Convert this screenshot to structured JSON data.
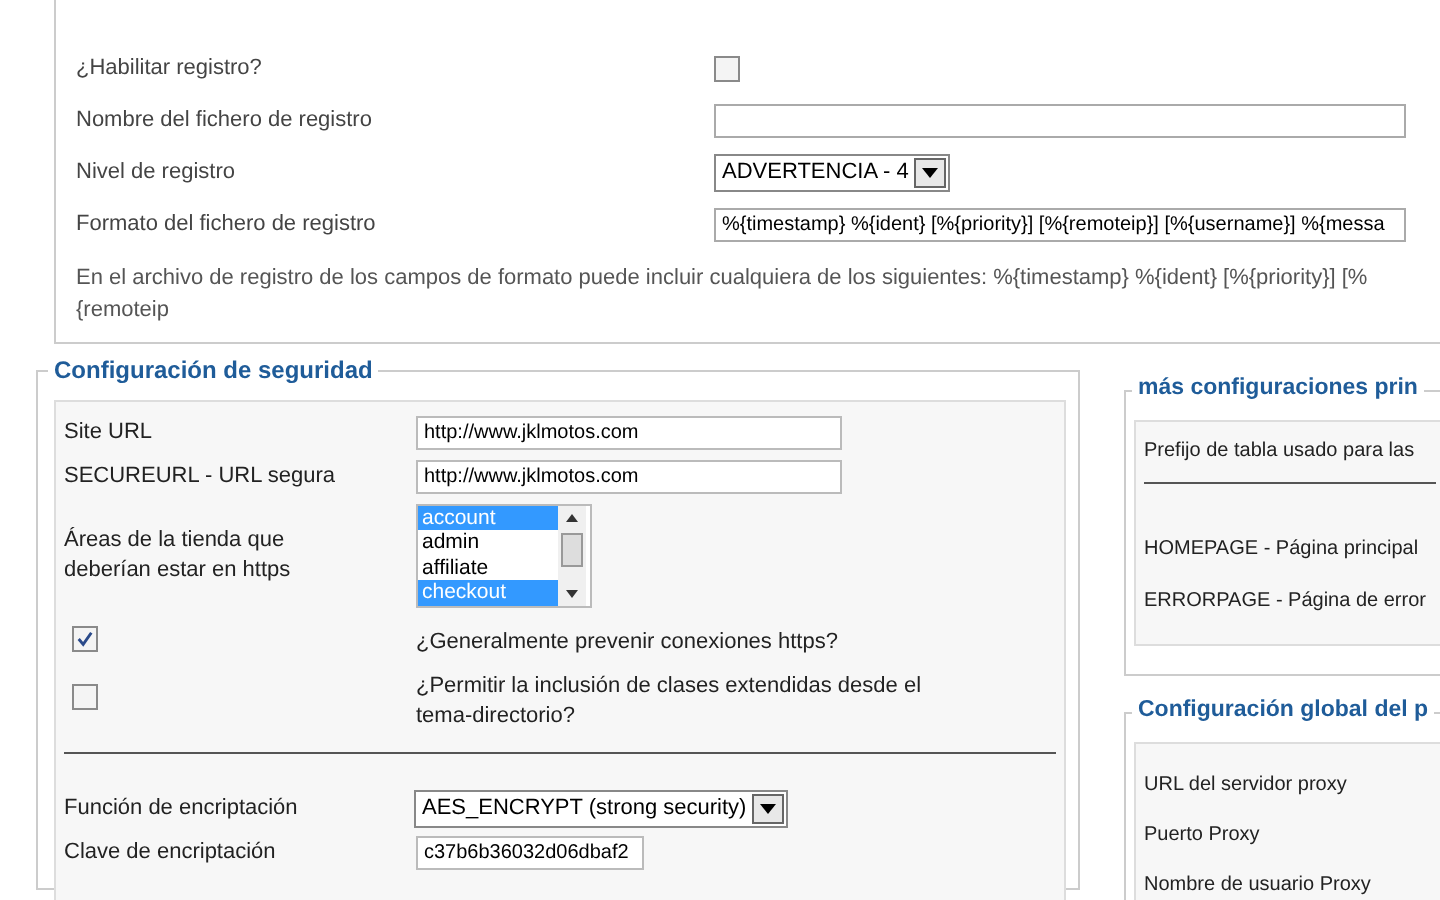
{
  "logging": {
    "rows": [
      {
        "kind": "checkbox",
        "label": "¿Habilitar registro?",
        "checked": false
      },
      {
        "kind": "text",
        "label": "Nombre del fichero de registro"
      },
      {
        "kind": "select",
        "label": "Nivel de registro",
        "value": "ADVERTENCIA - 4"
      },
      {
        "kind": "text",
        "label": "Formato del fichero de registro",
        "value": "%{timestamp} %{ident} [%{priority}] [%{remoteip}] [%{username}] %{messa"
      }
    ],
    "note": "En el archivo de registro de los campos de formato puede incluir cualquiera de los siguientes: %{timestamp} %{ident} [%{priority}] [%{remoteip"
  },
  "security": {
    "title": "Configuración de seguridad",
    "rows": [
      {
        "kind": "text",
        "label": "Site URL",
        "value": "http://www.jklmotos.com"
      },
      {
        "kind": "text",
        "label": "SECUREURL - URL segura",
        "value": "http://www.jklmotos.com"
      },
      {
        "kind": "list",
        "label": "Áreas de la tienda que deberían estar en https",
        "options": [
          {
            "label": "account",
            "selected": true
          },
          {
            "label": "admin",
            "selected": false
          },
          {
            "label": "affiliate",
            "selected": false
          },
          {
            "label": "checkout",
            "selected": true
          }
        ]
      },
      {
        "kind": "checkbox",
        "label": "¿Generalmente prevenir conexiones https?",
        "checked": true
      },
      {
        "kind": "checkbox",
        "label": "¿Permitir la inclusión de clases extendidas desde el tema-directorio?",
        "checked": false
      },
      {
        "kind": "divider"
      },
      {
        "kind": "select",
        "label": "Función de encriptación",
        "value": "AES_ENCRYPT (strong security)"
      },
      {
        "kind": "text",
        "label": "Clave de encriptación",
        "value": "c37b6b36032d06dbaf2"
      }
    ]
  },
  "more": {
    "title": "más configuraciones prin",
    "rows": [
      {
        "kind": "label",
        "label": "Prefijo de tabla usado para las"
      },
      {
        "kind": "divider"
      },
      {
        "kind": "label",
        "label": "HOMEPAGE - Página principal"
      },
      {
        "kind": "label",
        "label": "ERRORPAGE - Página de error"
      }
    ]
  },
  "proxy": {
    "title": "Configuración global del p",
    "rows": [
      {
        "label": "URL del servidor proxy"
      },
      {
        "label": "Puerto Proxy"
      },
      {
        "label": "Nombre de usuario Proxy"
      }
    ]
  }
}
